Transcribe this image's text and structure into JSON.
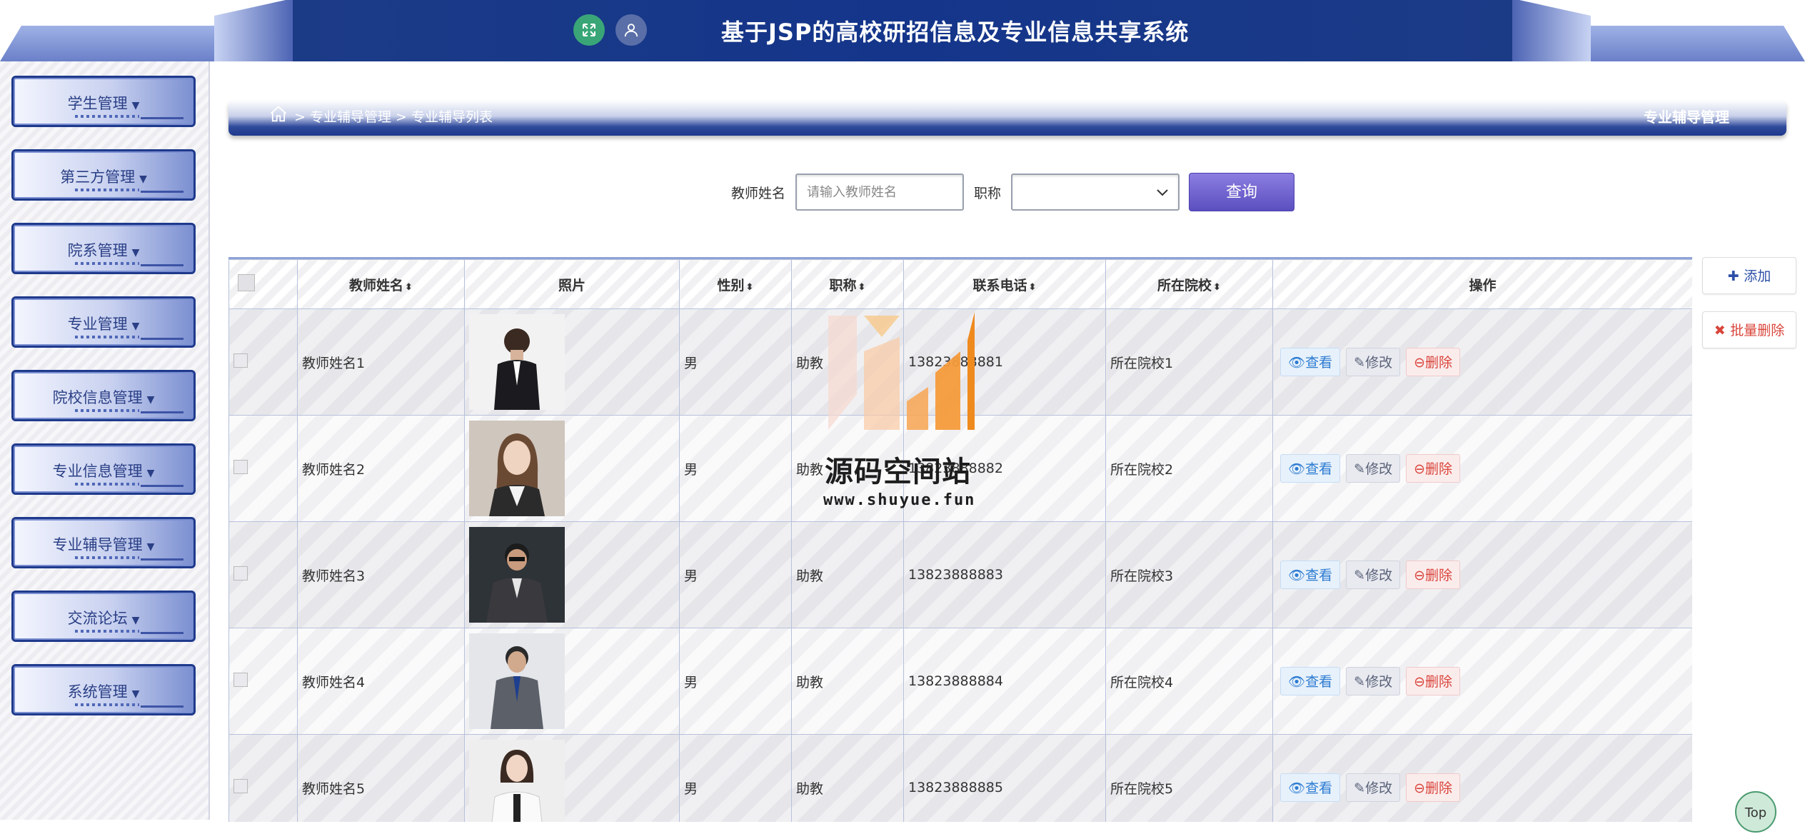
{
  "header": {
    "title": "基于JSP的高校研招信息及专业信息共享系统"
  },
  "sidebar": {
    "items": [
      {
        "label": "学生管理"
      },
      {
        "label": "第三方管理"
      },
      {
        "label": "院系管理"
      },
      {
        "label": "专业管理"
      },
      {
        "label": "院校信息管理"
      },
      {
        "label": "专业信息管理"
      },
      {
        "label": "专业辅导管理"
      },
      {
        "label": "交流论坛"
      },
      {
        "label": "系统管理"
      }
    ]
  },
  "breadcrumb": {
    "path": "> 专业辅导管理 > 专业辅导列表",
    "page_title": "专业辅导管理"
  },
  "search": {
    "name_label": "教师姓名",
    "name_placeholder": "请输入教师姓名",
    "title_label": "职称",
    "title_value": "",
    "button": "查询"
  },
  "table": {
    "headers": [
      "教师姓名",
      "照片",
      "性别",
      "职称",
      "联系电话",
      "所在院校",
      "操作"
    ],
    "rows": [
      {
        "name": "教师姓名1",
        "gender": "男",
        "title": "助教",
        "phone": "13823888881",
        "school": "所在院校1"
      },
      {
        "name": "教师姓名2",
        "gender": "男",
        "title": "助教",
        "phone": "13823888882",
        "school": "所在院校2"
      },
      {
        "name": "教师姓名3",
        "gender": "男",
        "title": "助教",
        "phone": "13823888883",
        "school": "所在院校3"
      },
      {
        "name": "教师姓名4",
        "gender": "男",
        "title": "助教",
        "phone": "13823888884",
        "school": "所在院校4"
      },
      {
        "name": "教师姓名5",
        "gender": "男",
        "title": "助教",
        "phone": "13823888885",
        "school": "所在院校5"
      }
    ],
    "actions": {
      "view": "查看",
      "edit": "修改",
      "delete": "删除"
    }
  },
  "side_actions": {
    "add": "添加",
    "batch_delete": "批量删除"
  },
  "top_button": "Top",
  "watermark": {
    "title": "源码空间站",
    "url": "www.shuyue.fun"
  },
  "colors": {
    "header_bg": "#14358a",
    "primary_button": "#5b4fc0",
    "view": "#2c7bd1",
    "delete": "#d9443a"
  }
}
